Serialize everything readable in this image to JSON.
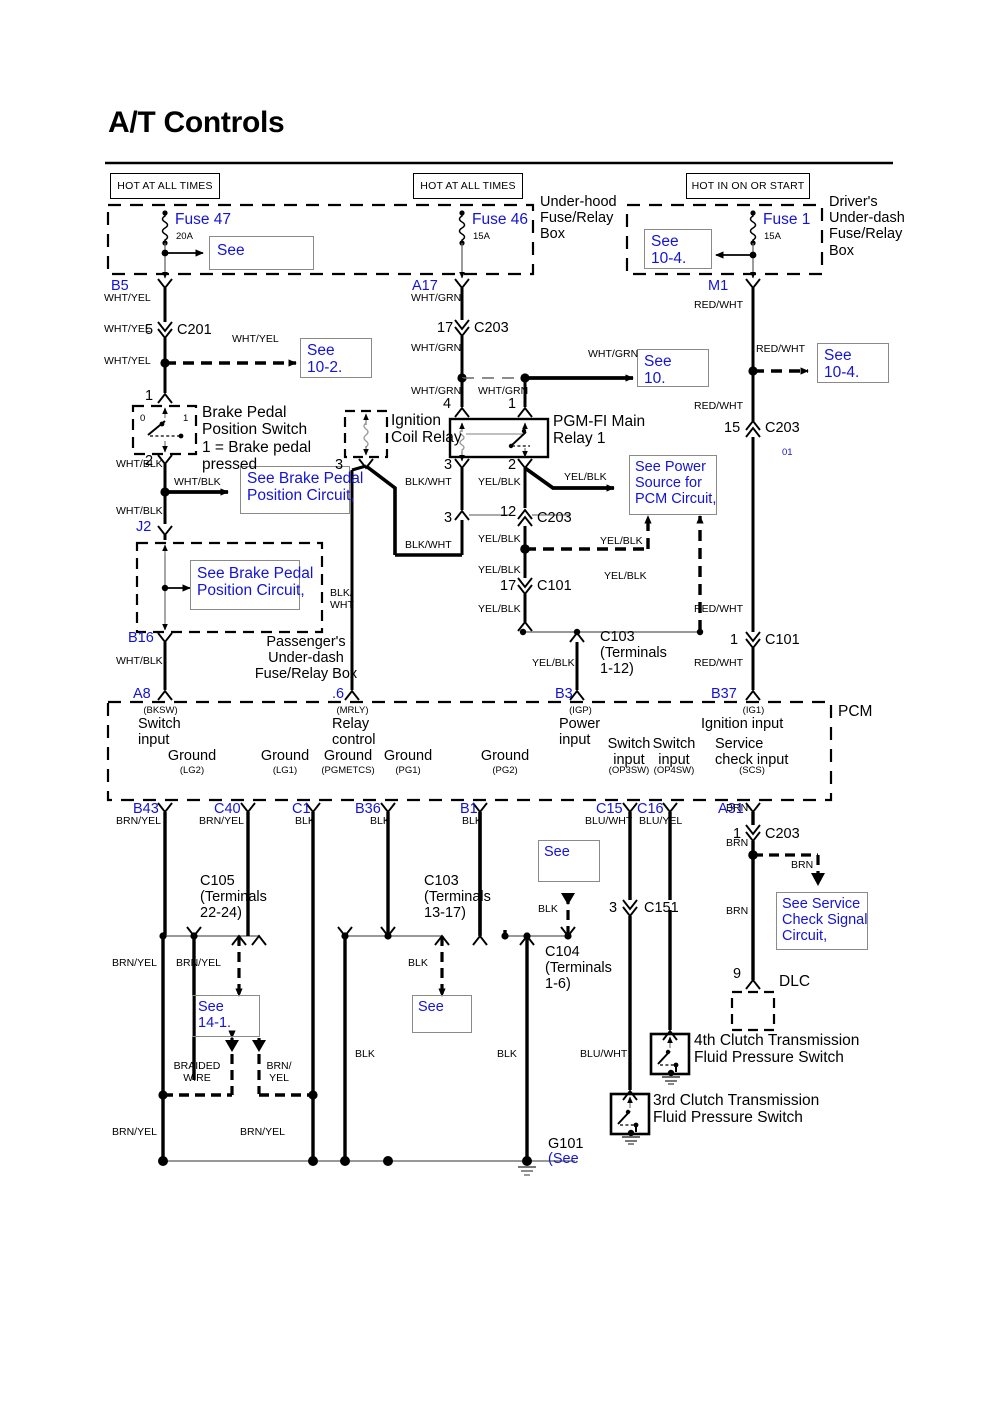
{
  "page": {
    "title": "A/T Controls",
    "pcm_label": "PCM"
  },
  "power_headers": [
    {
      "id": "hdr-1",
      "label": "HOT AT ALL TIMES"
    },
    {
      "id": "hdr-2",
      "label": "HOT AT ALL TIMES"
    },
    {
      "id": "hdr-3",
      "label": "HOT IN ON OR START"
    }
  ],
  "boxes": {
    "under_hood": "Under-hood\nFuse/Relay\nBox",
    "drivers_under_dash": "Driver's\nUnder-dash\nFuse/Relay\nBox",
    "passengers_under_dash": "Passenger's\nUnder-dash\nFuse/Relay Box"
  },
  "fuses": [
    {
      "name": "Fuse 47",
      "rating": "20A"
    },
    {
      "name": "Fuse 46",
      "rating": "15A"
    },
    {
      "name": "Fuse 1",
      "rating": "15A"
    }
  ],
  "refs": {
    "see_plain_1": "See",
    "see_10_4_a": "See\n10-4.",
    "see_10_2": "See\n10-2.",
    "see_10": "See\n10.",
    "see_10_4_b": "See\n10-4.",
    "see_brake_1": "See Brake Pedal\nPosition Circuit,",
    "see_brake_2": "See Brake Pedal\nPosition Circuit,",
    "see_power_pcm": "See Power\nSource for\nPCM Circuit,",
    "see_14_1": "See\n14-1.",
    "see_plain_2": "See",
    "see_plain_3": "See",
    "see_service_check": "See Service\nCheck Signal\nCircuit,",
    "g101_see": "(See"
  },
  "components": {
    "brake_switch": {
      "name": "Brake Pedal\nPosition Switch\n1 = Brake pedal\npressed",
      "pos_0": "0",
      "pos_1": "1",
      "term_in": "1",
      "term_out": "2"
    },
    "ignition_coil_relay": {
      "name": "Ignition\nCoil Relay",
      "term": "3"
    },
    "pgmfi_main_relay": {
      "name": "PGM-FI Main\nRelay 1",
      "t4": "4",
      "t1": "1",
      "t3": "3",
      "t2": "2"
    },
    "dlc": {
      "name": "DLC",
      "term": "9"
    },
    "clutch3": {
      "name": "3rd Clutch Transmission\nFluid Pressure Switch"
    },
    "clutch4": {
      "name": "4th Clutch Transmission\nFluid Pressure Switch"
    }
  },
  "terminals": {
    "b5": "B5",
    "a17": "A17",
    "m1": "M1",
    "j2": "J2",
    "b16": "B16",
    "a8": "A8",
    "mrly_pin": ".6",
    "b3": "B3",
    "b37": "B37",
    "b43": "B43",
    "c40": "C40",
    "c1": "C1",
    "b36": "B36",
    "b1": "B1",
    "c15": "C15",
    "c16": "C16",
    "a31": "A31",
    "note_01": "01"
  },
  "pcm_pins": [
    {
      "code": "(BKSW)",
      "label": "Switch\ninput"
    },
    {
      "code": "(MRLY)",
      "label": "Relay\ncontrol"
    },
    {
      "code": "(IGP)",
      "label": "Power\ninput"
    },
    {
      "code": "(IG1)",
      "label": "Ignition input"
    },
    {
      "code": "(LG2)",
      "label": "Ground"
    },
    {
      "code": "(LG1)",
      "label": "Ground"
    },
    {
      "code": "(PGMETCS)",
      "label": "Ground"
    },
    {
      "code": "(PG1)",
      "label": "Ground"
    },
    {
      "code": "(PG2)",
      "label": "Ground"
    },
    {
      "code": "(OP3SW)",
      "label": "Switch\ninput"
    },
    {
      "code": "(OP4SW)",
      "label": "Switch\ninput"
    },
    {
      "code": "(SCS)",
      "label": "Service\ncheck input"
    }
  ],
  "connectors": [
    {
      "id": "c201",
      "pin": "5",
      "name": "C201"
    },
    {
      "id": "c203a",
      "pin": "17",
      "name": "C203"
    },
    {
      "id": "c203b",
      "pin": "3",
      "name": ""
    },
    {
      "id": "c203c",
      "pin": "12",
      "name": "C203"
    },
    {
      "id": "c101a",
      "pin": "17",
      "name": "C101"
    },
    {
      "id": "c203d",
      "pin": "15",
      "name": "C203"
    },
    {
      "id": "c101b",
      "pin": "1",
      "name": "C101"
    },
    {
      "id": "c103a",
      "name": "C103\n(Terminals\n1-12)"
    },
    {
      "id": "c105",
      "name": "C105\n(Terminals\n22-24)"
    },
    {
      "id": "c103b",
      "name": "C103\n(Terminals\n13-17)"
    },
    {
      "id": "c104",
      "name": "C104\n(Terminals\n1-6)"
    },
    {
      "id": "c151",
      "pin": "3",
      "name": "C151"
    },
    {
      "id": "c203e",
      "pin": "1",
      "name": "C203"
    },
    {
      "id": "g101",
      "name": "G101"
    }
  ],
  "wire_colors": {
    "wht_yel": "WHT/YEL",
    "wht_grn": "WHT/GRN",
    "red_wht": "RED/WHT",
    "wht_blk": "WHT/BLK",
    "blk_wht": "BLK/WHT",
    "blk_wht_2": "BLK/\nWHT",
    "yel_blk": "YEL/BLK",
    "brn_yel": "BRN/YEL",
    "brn_yel_2": "BRN/\nYEL",
    "blk": "BLK",
    "blu_wht": "BLU/WHT",
    "blu_yel": "BLU/YEL",
    "brn": "BRN",
    "braided": "BRAIDED\nWIRE"
  },
  "colors": {
    "wire": "#000000",
    "link_blue": "#1414d2",
    "thin_gray": "#555555",
    "background": "#ffffff"
  }
}
